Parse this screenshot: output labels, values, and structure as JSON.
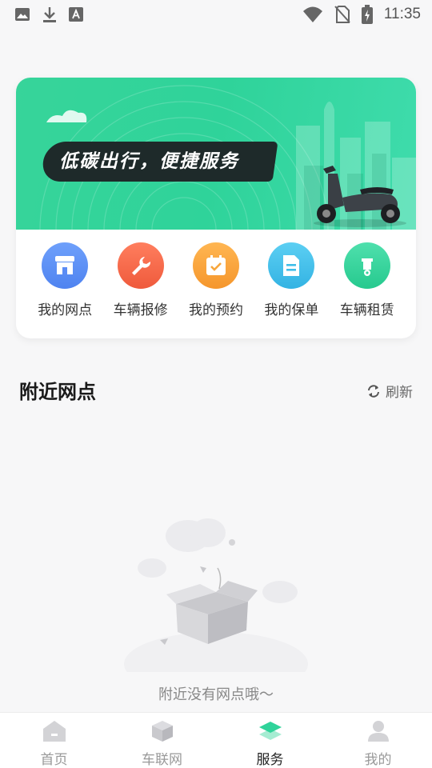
{
  "status_bar": {
    "time": "11:35",
    "icons": [
      "image-icon",
      "download-icon",
      "font-icon",
      "wifi-icon",
      "no-sim-icon",
      "battery-charging-icon"
    ]
  },
  "banner": {
    "slogan": "低碳出行，便捷服务",
    "colors": {
      "accent": "#2fd39a",
      "slogan_bg": "#1e2a2a"
    }
  },
  "quick_actions": [
    {
      "label": "我的网点",
      "icon": "store-icon",
      "color": "#5b8cf5"
    },
    {
      "label": "车辆报修",
      "icon": "wrench-icon",
      "color": "#f56b4f"
    },
    {
      "label": "我的预约",
      "icon": "calendar-check-icon",
      "color": "#f7a63c"
    },
    {
      "label": "我的保单",
      "icon": "document-icon",
      "color": "#3fbde8"
    },
    {
      "label": "车辆租赁",
      "icon": "scooter-icon",
      "color": "#34d39b"
    }
  ],
  "nearby": {
    "title": "附近网点",
    "refresh_label": "刷新",
    "empty_text": "附近没有网点哦～"
  },
  "tabbar": {
    "tabs": [
      {
        "label": "首页",
        "icon": "home-icon",
        "active": false
      },
      {
        "label": "车联网",
        "icon": "cube-icon",
        "active": false
      },
      {
        "label": "服务",
        "icon": "layers-icon",
        "active": true
      },
      {
        "label": "我的",
        "icon": "person-icon",
        "active": false
      }
    ]
  }
}
